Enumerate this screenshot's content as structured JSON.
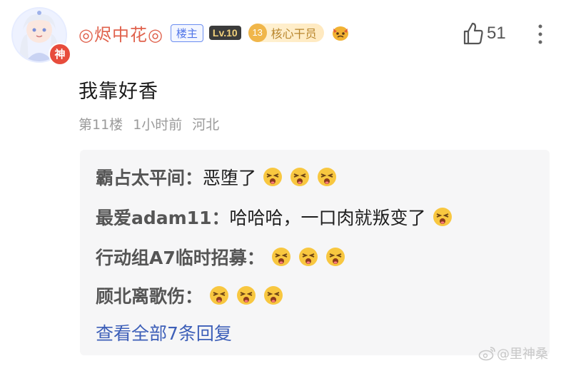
{
  "post": {
    "author": {
      "name": "◎烬中花◎",
      "op_badge": "楼主",
      "level": "Lv.10",
      "core_number": "13",
      "core_label": "核心干员",
      "avatar_badge": "神"
    },
    "likes": "51",
    "content": "我靠好香",
    "meta": {
      "floor": "第11楼",
      "time": "1小时前",
      "location": "河北"
    }
  },
  "replies": [
    {
      "author": "霸占太平间：",
      "text": "恶堕了",
      "emoji_count": 3
    },
    {
      "author": "最爱adam11：",
      "text": "哈哈哈，一口肉就叛变了",
      "emoji_count": 1
    },
    {
      "author": "行动组A7临时招募：",
      "text": "",
      "emoji_count": 3
    },
    {
      "author": "顾北离歌伤：",
      "text": "",
      "emoji_count": 3
    }
  ],
  "view_all": "查看全部7条回复",
  "watermark": "@里神桑",
  "colors": {
    "username": "#e0624d",
    "link": "#3d5fb8",
    "reply_bg": "#f6f6f7",
    "meta": "#9a9a9a"
  },
  "icons": {
    "like": "thumb-up-icon",
    "more": "more-vertical-icon",
    "emoji": "squinting-face-emoji-icon",
    "watermark": "weibo-logo-icon"
  }
}
